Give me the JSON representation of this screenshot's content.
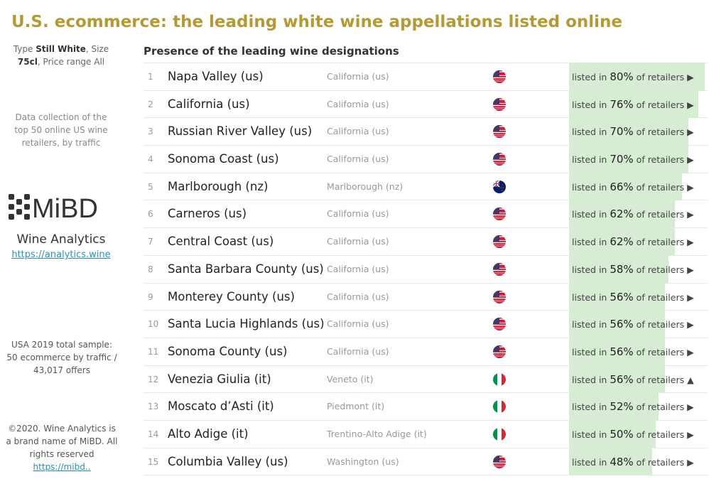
{
  "title": "U.S. ecommerce: the leading white wine appellations listed online",
  "sidebar": {
    "filters": {
      "type_label": "Type",
      "type_value": "Still White",
      "size_label": ", Size",
      "size_value": "75cl",
      "price_label": ", Price range All"
    },
    "collection_note": "Data collection of the top 50 online US wine retailers, by traffic",
    "logo_text": "MiBD",
    "brand": "Wine Analytics",
    "brand_link": "https://analytics.wine",
    "sample_note": "USA 2019 total sample: 50 ecommerce by traffic  / 43,017 offers",
    "copyright_text": "©2020. Wine Analytics is a brand name of MiBD. All rights reserved",
    "copyright_link": "https://mibd.."
  },
  "chart_data": {
    "type": "bar",
    "title": "Presence of the leading wine designations",
    "bar_prefix": "listed in",
    "bar_suffix": "of retailers",
    "xlim": [
      0,
      100
    ],
    "colors": {
      "bar": "#d6ecd3",
      "title": "#b59a33"
    },
    "rows": [
      {
        "rank": "1",
        "name": "Napa Valley (us)",
        "region": "California (us)",
        "flag": "us",
        "value": 80,
        "label": "80%",
        "trend": "▶"
      },
      {
        "rank": "2",
        "name": "California (us)",
        "region": "California (us)",
        "flag": "us",
        "value": 76,
        "label": "76%",
        "trend": "▶"
      },
      {
        "rank": "3",
        "name": "Russian River Valley (us)",
        "region": "California (us)",
        "flag": "us",
        "value": 70,
        "label": "70%",
        "trend": "▶"
      },
      {
        "rank": "4",
        "name": "Sonoma Coast (us)",
        "region": "California (us)",
        "flag": "us",
        "value": 70,
        "label": "70%",
        "trend": "▶"
      },
      {
        "rank": "5",
        "name": "Marlborough (nz)",
        "region": "Marlborough (nz)",
        "flag": "nz",
        "value": 66,
        "label": "66%",
        "trend": "▶"
      },
      {
        "rank": "6",
        "name": "Carneros (us)",
        "region": "California (us)",
        "flag": "us",
        "value": 62,
        "label": "62%",
        "trend": "▶"
      },
      {
        "rank": "7",
        "name": "Central Coast (us)",
        "region": "California (us)",
        "flag": "us",
        "value": 62,
        "label": "62%",
        "trend": "▶"
      },
      {
        "rank": "8",
        "name": "Santa Barbara County (us)",
        "region": "California (us)",
        "flag": "us",
        "value": 58,
        "label": "58%",
        "trend": "▶"
      },
      {
        "rank": "9",
        "name": "Monterey County (us)",
        "region": "California (us)",
        "flag": "us",
        "value": 56,
        "label": "56%",
        "trend": "▶"
      },
      {
        "rank": "10",
        "name": "Santa Lucia Highlands (us)",
        "region": "California (us)",
        "flag": "us",
        "value": 56,
        "label": "56%",
        "trend": "▶"
      },
      {
        "rank": "11",
        "name": "Sonoma County (us)",
        "region": "California (us)",
        "flag": "us",
        "value": 56,
        "label": "56%",
        "trend": "▶"
      },
      {
        "rank": "12",
        "name": "Venezia Giulia (it)",
        "region": "Veneto (it)",
        "flag": "it",
        "value": 56,
        "label": "56%",
        "trend": "▲"
      },
      {
        "rank": "13",
        "name": "Moscato d’Asti (it)",
        "region": "Piedmont (it)",
        "flag": "it",
        "value": 52,
        "label": "52%",
        "trend": "▶"
      },
      {
        "rank": "14",
        "name": "Alto Adige (it)",
        "region": "Trentino-Alto Adige (it)",
        "flag": "it",
        "value": 50,
        "label": "50%",
        "trend": "▶"
      },
      {
        "rank": "15",
        "name": "Columbia Valley (us)",
        "region": "Washington (us)",
        "flag": "us",
        "value": 48,
        "label": "48%",
        "trend": "▶"
      }
    ]
  }
}
